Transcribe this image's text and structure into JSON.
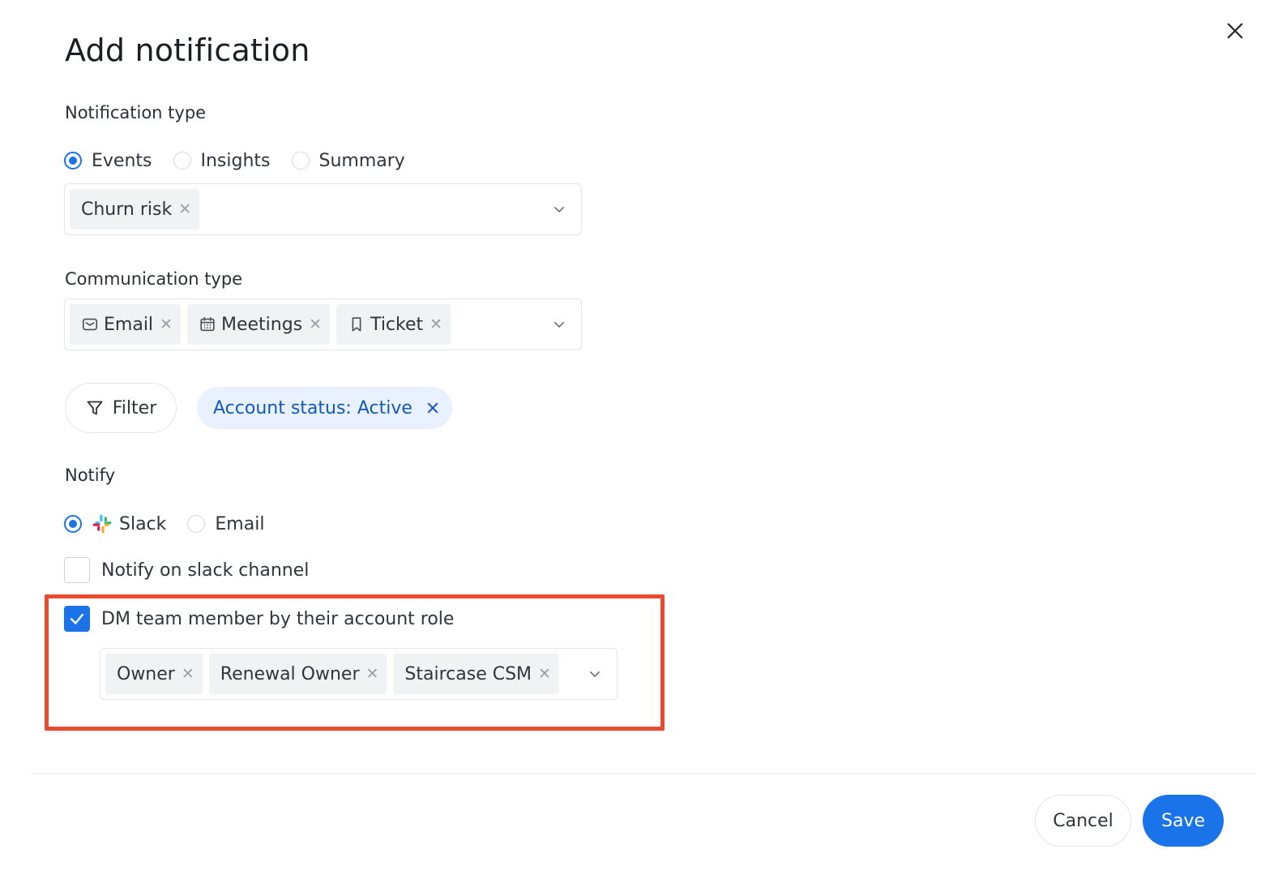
{
  "dialog": {
    "title": "Add notification",
    "close_icon": "close-icon"
  },
  "notification_type": {
    "label": "Notification type",
    "options": [
      {
        "label": "Events",
        "checked": true
      },
      {
        "label": "Insights",
        "checked": false
      },
      {
        "label": "Summary",
        "checked": false
      }
    ],
    "selected_chips": [
      {
        "label": "Churn risk"
      }
    ]
  },
  "communication_type": {
    "label": "Communication type",
    "selected_chips": [
      {
        "label": "Email",
        "icon": "mail-icon"
      },
      {
        "label": "Meetings",
        "icon": "calendar-icon"
      },
      {
        "label": "Ticket",
        "icon": "bookmark-icon"
      }
    ]
  },
  "filter": {
    "button_label": "Filter",
    "active_tag": "Account status: Active"
  },
  "notify": {
    "label": "Notify",
    "options": [
      {
        "label": "Slack",
        "checked": true,
        "icon": "slack-logo"
      },
      {
        "label": "Email",
        "checked": false
      }
    ],
    "slack_channel_checkbox": {
      "label": "Notify on slack channel",
      "checked": false
    },
    "dm_checkbox": {
      "label": "DM team member by their account role",
      "checked": true
    },
    "roles": [
      {
        "label": "Owner"
      },
      {
        "label": "Renewal Owner"
      },
      {
        "label": "Staircase CSM"
      }
    ]
  },
  "footer": {
    "cancel_label": "Cancel",
    "save_label": "Save"
  },
  "colors": {
    "accent": "#1a73e8",
    "highlight_border": "#ea4a2f",
    "filter_tag_bg": "#e8f1fd",
    "filter_tag_text": "#1559b8"
  }
}
